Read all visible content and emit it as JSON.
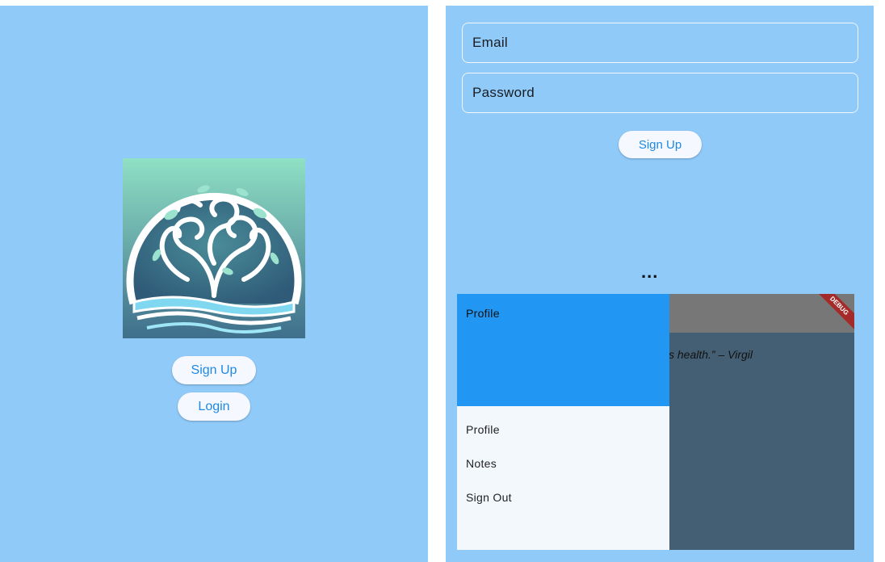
{
  "welcome_screen": {
    "logo_icon": "tree-wave-logo",
    "signup_label": "Sign Up",
    "login_label": "Login"
  },
  "signup_screen": {
    "email_placeholder": "Email",
    "password_placeholder": "Password",
    "signup_label": "Sign Up",
    "dots": "..."
  },
  "home_screen": {
    "quote_fragment": "s health.” – Virgil",
    "debug_banner": "DEBUG",
    "drawer": {
      "header_title": "Profile",
      "items": [
        {
          "label": "Profile"
        },
        {
          "label": "Notes"
        },
        {
          "label": "Sign Out"
        }
      ]
    }
  },
  "colors": {
    "background": "#90caf9",
    "button_bg": "#f5f9ff",
    "button_text": "#1e88e5",
    "drawer_header": "#2196f3",
    "drawer_bg": "#f3f8fd",
    "scrim": "#445f74",
    "appbar_dim": "#777777",
    "debug": "#a52a2a"
  }
}
